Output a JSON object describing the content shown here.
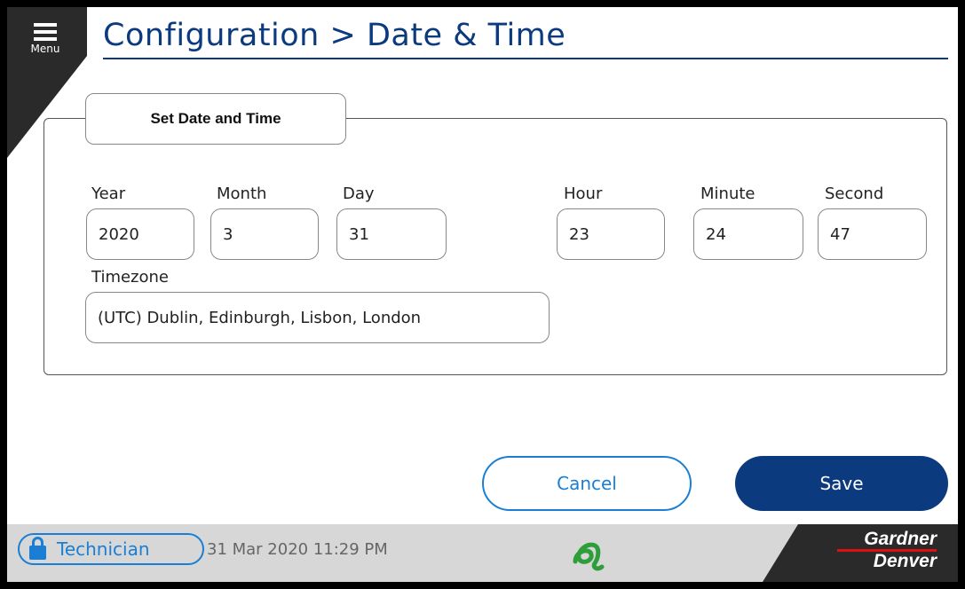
{
  "header": {
    "menu_label": "Menu",
    "title": "Configuration > Date & Time"
  },
  "group": {
    "title": "Set Date and Time",
    "fields": {
      "year": {
        "label": "Year",
        "value": "2020"
      },
      "month": {
        "label": "Month",
        "value": "3"
      },
      "day": {
        "label": "Day",
        "value": "31"
      },
      "hour": {
        "label": "Hour",
        "value": "23"
      },
      "minute": {
        "label": "Minute",
        "value": "24"
      },
      "second": {
        "label": "Second",
        "value": "47"
      },
      "timezone": {
        "label": "Timezone",
        "value": "(UTC) Dublin, Edinburgh, Lisbon, London"
      }
    }
  },
  "actions": {
    "cancel_label": "Cancel",
    "save_label": "Save"
  },
  "status_bar": {
    "user_role": "Technician",
    "datetime": "31 Mar 2020  11:29 PM",
    "brand_line1": "Gardner",
    "brand_line2": "Denver",
    "icons": [
      "lock-icon",
      "company-logo-icon"
    ]
  },
  "colors": {
    "primary_dark_blue": "#0b3a7e",
    "accent_blue": "#1a7fd4",
    "logo_green": "#2e9e3a",
    "brand_red": "#dd1111"
  }
}
